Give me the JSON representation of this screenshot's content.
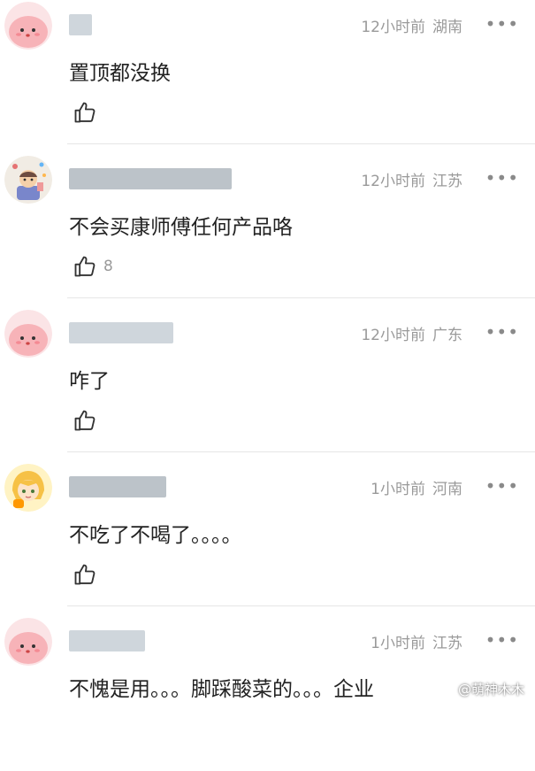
{
  "comments": [
    {
      "user_color": "#cfd6dc",
      "time": "12小时前",
      "location": "湖南",
      "text": "置顶都没换",
      "likes": "",
      "avatar": "pink-blob"
    },
    {
      "user_color": "#bcc3c9",
      "time": "12小时前",
      "location": "江苏",
      "text": "不会买康师傅任何产品咯",
      "likes": "8",
      "avatar": "cartoon-kid"
    },
    {
      "user_color": "#cfd6dc",
      "time": "12小时前",
      "location": "广东",
      "text": "咋了",
      "likes": "",
      "avatar": "pink-blob"
    },
    {
      "user_color": "#bcc3c9",
      "time": "1小时前",
      "location": "河南",
      "text": "不吃了不喝了。。。。",
      "likes": "",
      "avatar": "anime-girl"
    },
    {
      "user_color": "#cfd6dc",
      "time": "1小时前",
      "location": "江苏",
      "text": "不愧是用。。。脚踩酸菜的。。。企业",
      "likes": "",
      "avatar": "pink-blob"
    }
  ],
  "more_label": "•••",
  "watermark": "@萌神木木"
}
